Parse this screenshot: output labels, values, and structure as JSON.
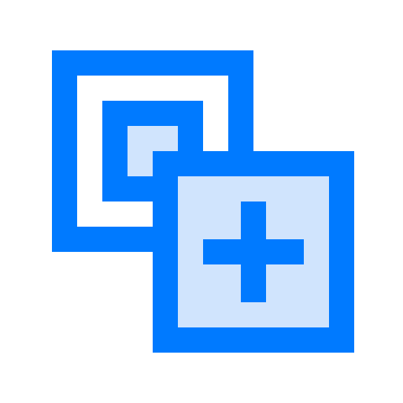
{
  "icon": {
    "name": "add-layer-icon",
    "parts": [
      "back-square-icon",
      "inner-square-icon",
      "front-square-icon",
      "plus-icon"
    ]
  },
  "colors": {
    "stroke": "#007aff",
    "fill_light": "#d0e4fd",
    "background": "#ffffff"
  }
}
